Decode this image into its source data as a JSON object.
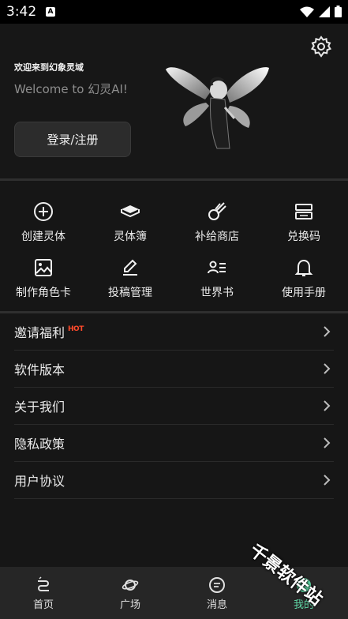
{
  "status_bar": {
    "time": "3:42",
    "app_indicator": "A",
    "icons": [
      "wifi-icon",
      "signal-icon",
      "battery-icon"
    ]
  },
  "header": {
    "welcome_cn": "欢迎来到幻象灵域",
    "welcome_en": "Welcome to 幻灵AI!",
    "login_label": "登录/注册",
    "settings_icon": "gear-icon"
  },
  "grid": {
    "items": [
      {
        "label": "创建灵体",
        "icon": "plus-circle-icon"
      },
      {
        "label": "灵体簿",
        "icon": "book-icon"
      },
      {
        "label": "补给商店",
        "icon": "meteor-icon"
      },
      {
        "label": "兑换码",
        "icon": "redeem-card-icon"
      },
      {
        "label": "制作角色卡",
        "icon": "image-icon"
      },
      {
        "label": "投稿管理",
        "icon": "edit-icon"
      },
      {
        "label": "世界书",
        "icon": "user-list-icon"
      },
      {
        "label": "使用手册",
        "icon": "bell-icon"
      }
    ]
  },
  "menu": {
    "items": [
      {
        "label": "邀请福利",
        "badge": "HOT"
      },
      {
        "label": "软件版本"
      },
      {
        "label": "关于我们"
      },
      {
        "label": "隐私政策"
      },
      {
        "label": "用户协议"
      }
    ]
  },
  "watermark": "千景软件站",
  "tabs": [
    {
      "label": "首页",
      "icon": "home-icon"
    },
    {
      "label": "广场",
      "icon": "planet-icon"
    },
    {
      "label": "消息",
      "icon": "message-icon"
    },
    {
      "label": "我的",
      "icon": "profile-icon",
      "active": true
    }
  ],
  "colors": {
    "accent": "#5fd6a4",
    "hot": "#ff4a2b",
    "background": "#161616"
  }
}
